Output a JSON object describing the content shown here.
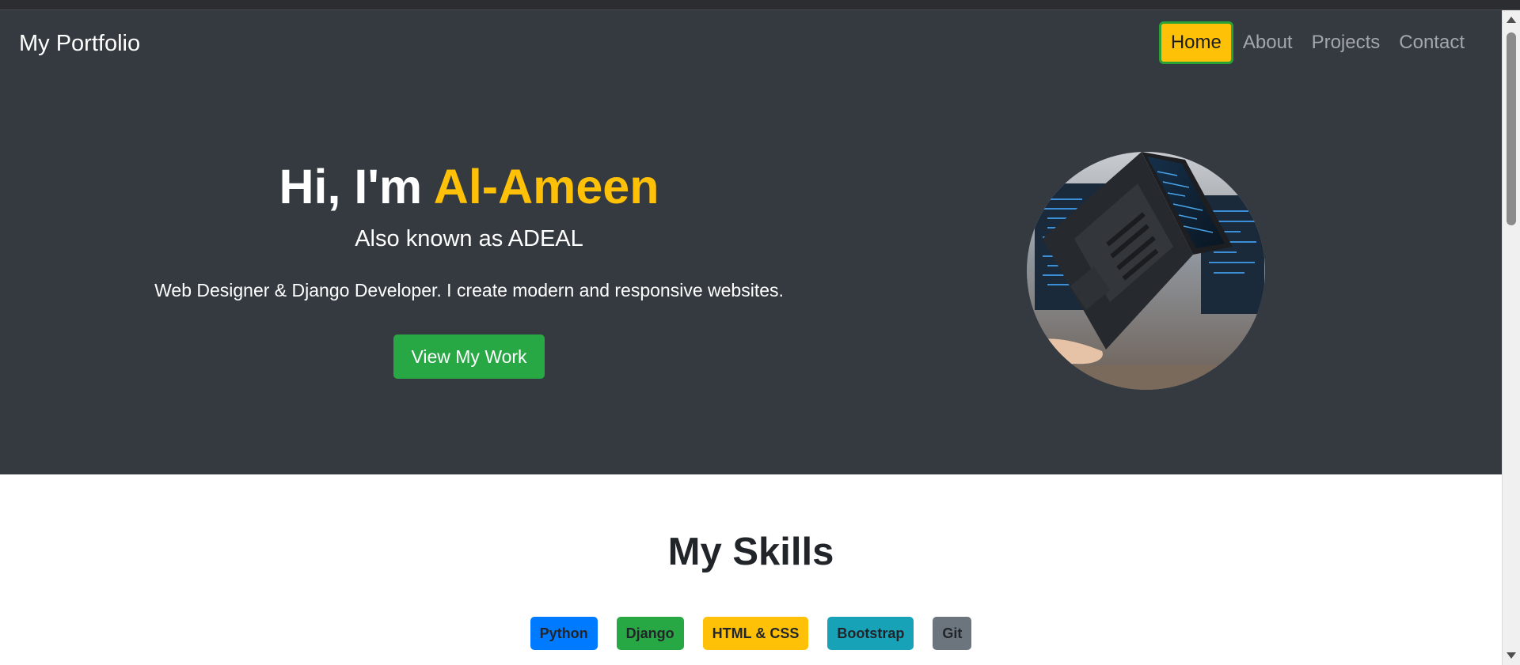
{
  "navbar": {
    "brand": "My Portfolio",
    "links": [
      {
        "label": "Home",
        "active": true
      },
      {
        "label": "About",
        "active": false
      },
      {
        "label": "Projects",
        "active": false
      },
      {
        "label": "Contact",
        "active": false
      }
    ]
  },
  "hero": {
    "greeting": "Hi, I'm ",
    "name": "Al-Ameen",
    "subtitle": "Also known as ADEAL",
    "description": "Web Designer & Django Developer. I create modern and responsive websites.",
    "cta_label": "View My Work",
    "photo_icon": "laptop-photo"
  },
  "skills": {
    "title": "My Skills",
    "badges": [
      {
        "label": "Python",
        "color": "#007bff"
      },
      {
        "label": "Django",
        "color": "#28a745"
      },
      {
        "label": "HTML & CSS",
        "color": "#ffc107"
      },
      {
        "label": "Bootstrap",
        "color": "#17a2b8"
      },
      {
        "label": "Git",
        "color": "#6c757d"
      }
    ]
  },
  "colors": {
    "dark": "#343a40",
    "accent": "#ffc107",
    "success": "#28a745"
  }
}
